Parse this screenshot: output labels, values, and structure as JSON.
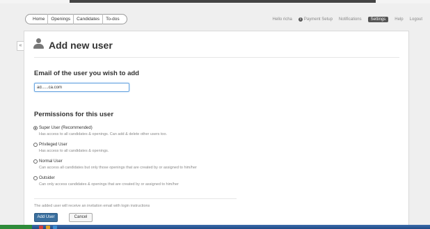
{
  "nav": {
    "items": [
      "Home",
      "Openings",
      "Candidates",
      "To-dos"
    ]
  },
  "header_right": {
    "greeting": "Hello richa",
    "payment_setup": "Payment Setup",
    "notifications": "Notifications",
    "settings": "Settings",
    "help": "Help",
    "logout": "Logout"
  },
  "collapse_glyph": "«",
  "page": {
    "title": "Add new user"
  },
  "email_section": {
    "heading": "Email of the user you wish to add",
    "value": "ad......ca.com"
  },
  "permissions": {
    "heading": "Permissions for this user",
    "selected_index": 0,
    "options": [
      {
        "label": "Super User (Recommended)",
        "description": "Has access to all candidates & openings. Can add & delete other users too."
      },
      {
        "label": "Privileged User",
        "description": "Has access to all candidates & openings."
      },
      {
        "label": "Normal User",
        "description": "Can access all candidates but only those openings that are created by or assigned to him/her"
      },
      {
        "label": "Outsider",
        "description": "Can only access candidates & openings that are created by or assigned to him/her"
      }
    ]
  },
  "footer": {
    "note": "The added user will receive an invitation email with login instructions",
    "add_button": "Add User",
    "cancel_button": "Cancel"
  },
  "colors": {
    "primary_button": "#3a6f9e",
    "settings_active": "#555555",
    "input_focus": "#6aa6e0"
  }
}
